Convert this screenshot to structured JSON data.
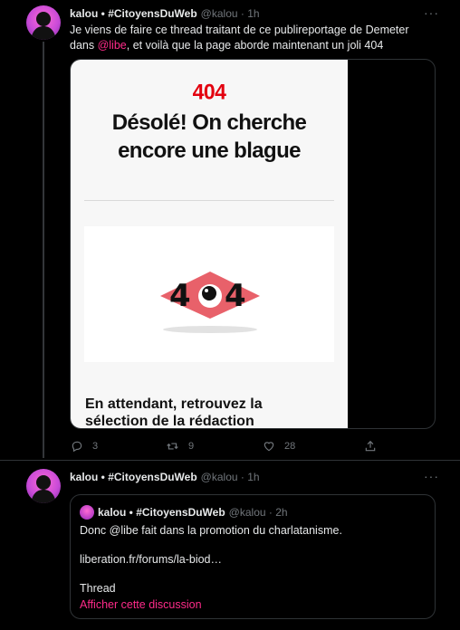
{
  "tweet1": {
    "name": "kalou • #CitoyensDuWeb",
    "handle": "@kalou · 1h",
    "text_before": "Je viens de faire ce thread traitant de ce publireportage de Demeter dans ",
    "mention": "@libe",
    "text_after": ", et voilà que la page aborde maintenant un joli 404",
    "media": {
      "code": "404",
      "headline_line1": "Désolé! On cherche",
      "headline_line2": "encore une blague",
      "graphic_digit_left": "4",
      "graphic_digit_right": "4",
      "footer_line1": "En attendant, retrouvez la",
      "footer_line2": "sélection de la rédaction"
    },
    "actions": {
      "replies": "3",
      "retweets": "9",
      "likes": "28"
    }
  },
  "tweet2": {
    "name": "kalou • #CitoyensDuWeb",
    "handle": "@kalou · 1h",
    "quote": {
      "name": "kalou • #CitoyensDuWeb",
      "handle": "@kalou · 2h",
      "text": "Donc @libe fait dans la promotion du charlatanisme.",
      "link": "liberation.fr/forums/la-biod…",
      "thread_label": "Thread",
      "show_discussion": "Afficher cette discussion"
    }
  },
  "colors": {
    "accent": "#ff2b8a",
    "background": "#000000",
    "muted": "#71767b",
    "liberation_red": "#e3000f"
  },
  "icons": [
    "reply-icon",
    "retweet-icon",
    "like-icon",
    "share-icon",
    "more-icon"
  ]
}
